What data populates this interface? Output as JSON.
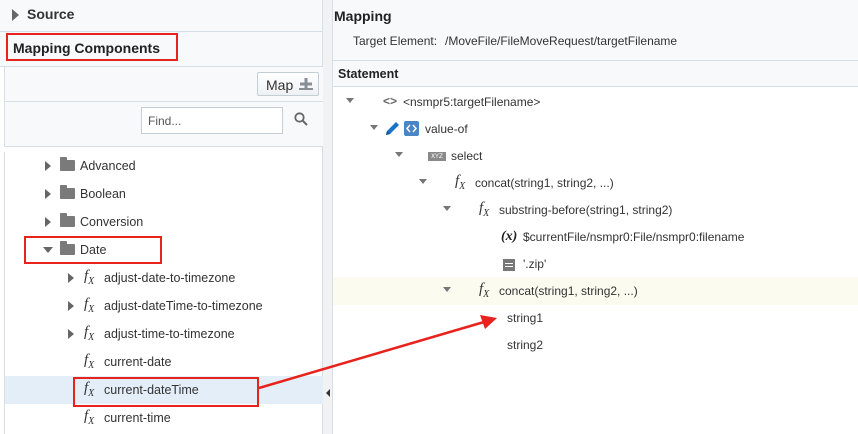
{
  "left": {
    "source_label": "Source",
    "components_label": "Mapping Components",
    "map_button": "Map",
    "find_placeholder": "Find...",
    "tree": [
      {
        "label": "Advanced",
        "type": "folder",
        "expanded": false
      },
      {
        "label": "Boolean",
        "type": "folder",
        "expanded": false
      },
      {
        "label": "Conversion",
        "type": "folder",
        "expanded": false
      },
      {
        "label": "Date",
        "type": "folder",
        "expanded": true
      },
      {
        "label": "adjust-date-to-timezone",
        "type": "function",
        "expandable": true
      },
      {
        "label": "adjust-dateTime-to-timezone",
        "type": "function",
        "expandable": true
      },
      {
        "label": "adjust-time-to-timezone",
        "type": "function",
        "expandable": true
      },
      {
        "label": "current-date",
        "type": "function"
      },
      {
        "label": "current-dateTime",
        "type": "function",
        "selected": true
      },
      {
        "label": "current-time",
        "type": "function"
      }
    ]
  },
  "mapping": {
    "title": "Mapping",
    "target_label": "Target Element:",
    "target_value": "/MoveFile/FileMoveRequest/targetFilename"
  },
  "statement": {
    "title": "Statement",
    "rows": [
      {
        "label": "<nsmpr5:targetFilename>",
        "icon": "tag-icon"
      },
      {
        "label": "value-of",
        "icon": "value-of-icon"
      },
      {
        "label": "select",
        "icon": "xyz-icon"
      },
      {
        "label": "concat(string1, string2, ...)",
        "icon": "fx-icon"
      },
      {
        "label": "substring-before(string1, string2)",
        "icon": "fx-icon"
      },
      {
        "label": "$currentFile/nsmpr0:File/nsmpr0:filename",
        "icon": "variable-icon"
      },
      {
        "label": "'.zip'",
        "icon": "literal-icon"
      },
      {
        "label": "concat(string1, string2, ...)",
        "icon": "fx-icon",
        "highlighted": true
      },
      {
        "label": "string1",
        "icon": ""
      },
      {
        "label": "string2",
        "icon": ""
      }
    ]
  },
  "colors": {
    "annotation": "#e8221c",
    "selection": "#e4eef8",
    "highlight": "#fbfbf0",
    "pencil": "#1a73c7"
  }
}
